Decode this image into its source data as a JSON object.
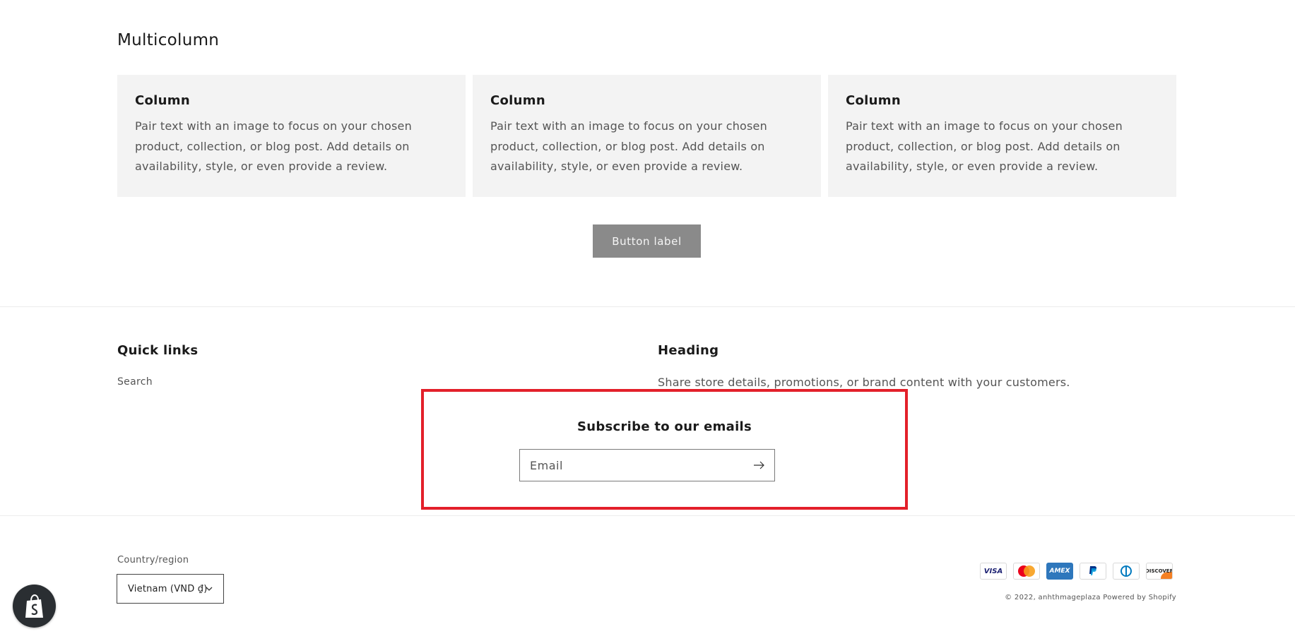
{
  "multicolumn": {
    "title": "Multicolumn",
    "columns": [
      {
        "title": "Column",
        "text": "Pair text with an image to focus on your chosen product, collection, or blog post. Add details on availability, style, or even provide a review."
      },
      {
        "title": "Column",
        "text": "Pair text with an image to focus on your chosen product, collection, or blog post. Add details on availability, style, or even provide a review."
      },
      {
        "title": "Column",
        "text": "Pair text with an image to focus on your chosen product, collection, or blog post. Add details on availability, style, or even provide a review."
      }
    ],
    "button_label": "Button label"
  },
  "footer": {
    "quick_links": {
      "heading": "Quick links",
      "links": [
        {
          "label": "Search"
        }
      ]
    },
    "info": {
      "heading": "Heading",
      "text": "Share store details, promotions, or brand content with your customers."
    },
    "newsletter": {
      "title": "Subscribe to our emails",
      "email_placeholder": "Email"
    },
    "country": {
      "label": "Country/region",
      "selected": "Vietnam (VND ₫)"
    },
    "payments": [
      {
        "icon": "visa-icon",
        "text": "VISA"
      },
      {
        "icon": "mastercard-icon",
        "text": ""
      },
      {
        "icon": "amex-icon",
        "text": "AMEX"
      },
      {
        "icon": "paypal-icon",
        "text": ""
      },
      {
        "icon": "diners-icon",
        "text": ""
      },
      {
        "icon": "discover-icon",
        "text": "DISCOVER"
      }
    ],
    "copyright": "© 2022, anhthmageplaza Powered by Shopify"
  },
  "colors": {
    "highlight": "#e3202a",
    "button_bg": "#8a8a8a",
    "card_bg": "#f3f3f3"
  }
}
